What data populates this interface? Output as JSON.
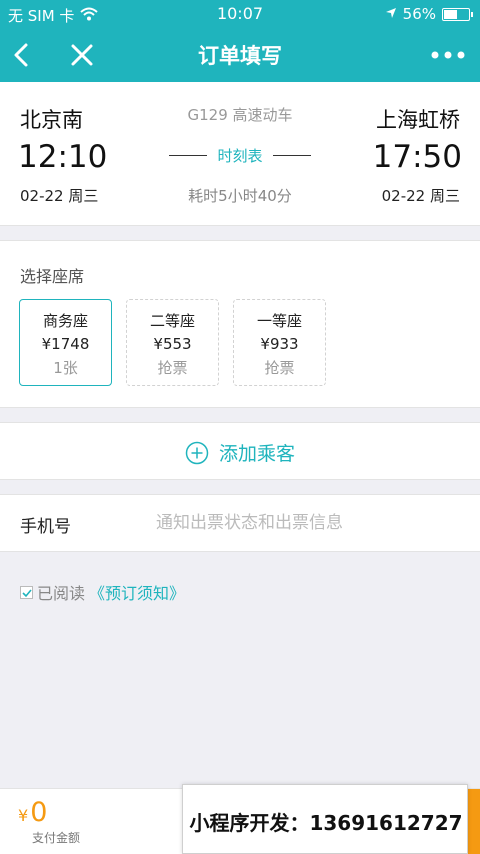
{
  "status_bar": {
    "carrier": "无 SIM 卡",
    "time": "10:07",
    "battery_percent": "56%",
    "battery_level": 0.56
  },
  "nav": {
    "title": "订单填写"
  },
  "train": {
    "from_station": "北京南",
    "to_station": "上海虹桥",
    "depart_time": "12:10",
    "arrive_time": "17:50",
    "depart_date": "02-22 周三",
    "arrive_date": "02-22 周三",
    "train_info": "G129 高速动车",
    "schedule_link": "时刻表",
    "duration": "耗时5小时40分"
  },
  "seats": {
    "label": "选择座席",
    "options": [
      {
        "name": "商务座",
        "price": "¥1748",
        "status": "1张",
        "selected": true
      },
      {
        "name": "二等座",
        "price": "¥553",
        "status": "抢票",
        "selected": false
      },
      {
        "name": "一等座",
        "price": "¥933",
        "status": "抢票",
        "selected": false
      }
    ]
  },
  "add_passenger": {
    "label": "添加乘客"
  },
  "phone": {
    "label": "手机号",
    "placeholder": "通知出票状态和出票信息",
    "value": ""
  },
  "agreement": {
    "checked": true,
    "prefix": "已阅读",
    "link": "《预订须知》"
  },
  "payment": {
    "currency": "¥",
    "amount": "0",
    "label": "支付金额"
  },
  "promo": {
    "text": "小程序开发：13691612727"
  },
  "colors": {
    "accent": "#1fb4bd",
    "pay": "#f59a12"
  }
}
